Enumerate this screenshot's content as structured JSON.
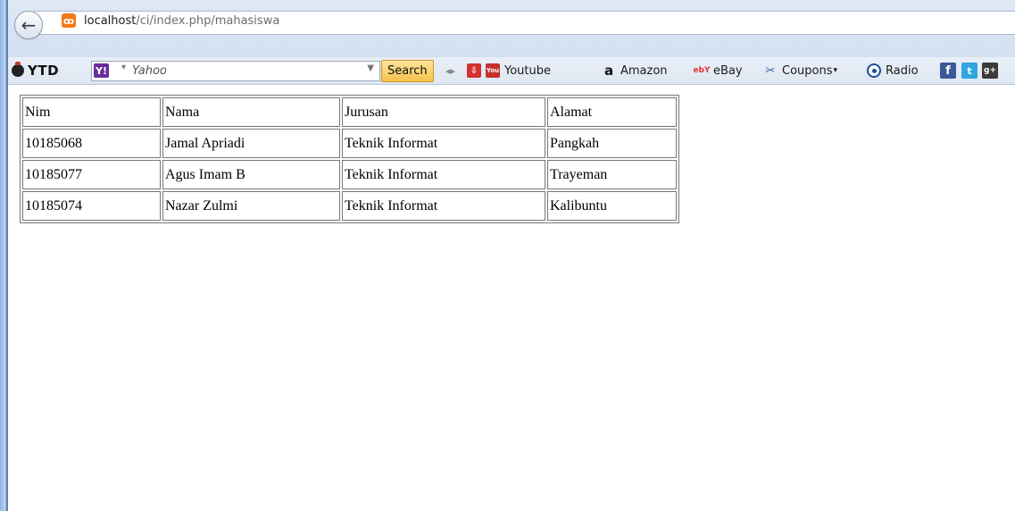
{
  "browser": {
    "url_host": "localhost",
    "url_path": "/ci/index.php/mahasiswa",
    "back_icon": "back-arrow-icon",
    "site_icon": "xampp-icon"
  },
  "toolbar": {
    "ytd_label": "YTD",
    "yahoo_placeholder": "Yahoo",
    "yahoo_logo": "Y!",
    "search_label": "Search",
    "links": [
      {
        "label": "Youtube",
        "icon": "youtube-icon"
      },
      {
        "label": "Amazon",
        "icon": "amazon-icon"
      },
      {
        "label": "eBay",
        "icon": "ebay-icon"
      },
      {
        "label": "Coupons",
        "icon": "coupons-icon"
      },
      {
        "label": "Radio",
        "icon": "radio-icon"
      }
    ],
    "social": [
      "facebook-icon",
      "twitter-icon",
      "google-plus-icon"
    ]
  },
  "table": {
    "headers": [
      "Nim",
      "Nama",
      "Jurusan",
      "Alamat"
    ],
    "rows": [
      [
        "10185068",
        "Jamal Apriadi",
        "Teknik Informat",
        "Pangkah"
      ],
      [
        "10185077",
        "Agus Imam B",
        "Teknik Informat",
        "Trayeman"
      ],
      [
        "10185074",
        "Nazar Zulmi",
        "Teknik Informat",
        "Kalibuntu"
      ]
    ]
  }
}
